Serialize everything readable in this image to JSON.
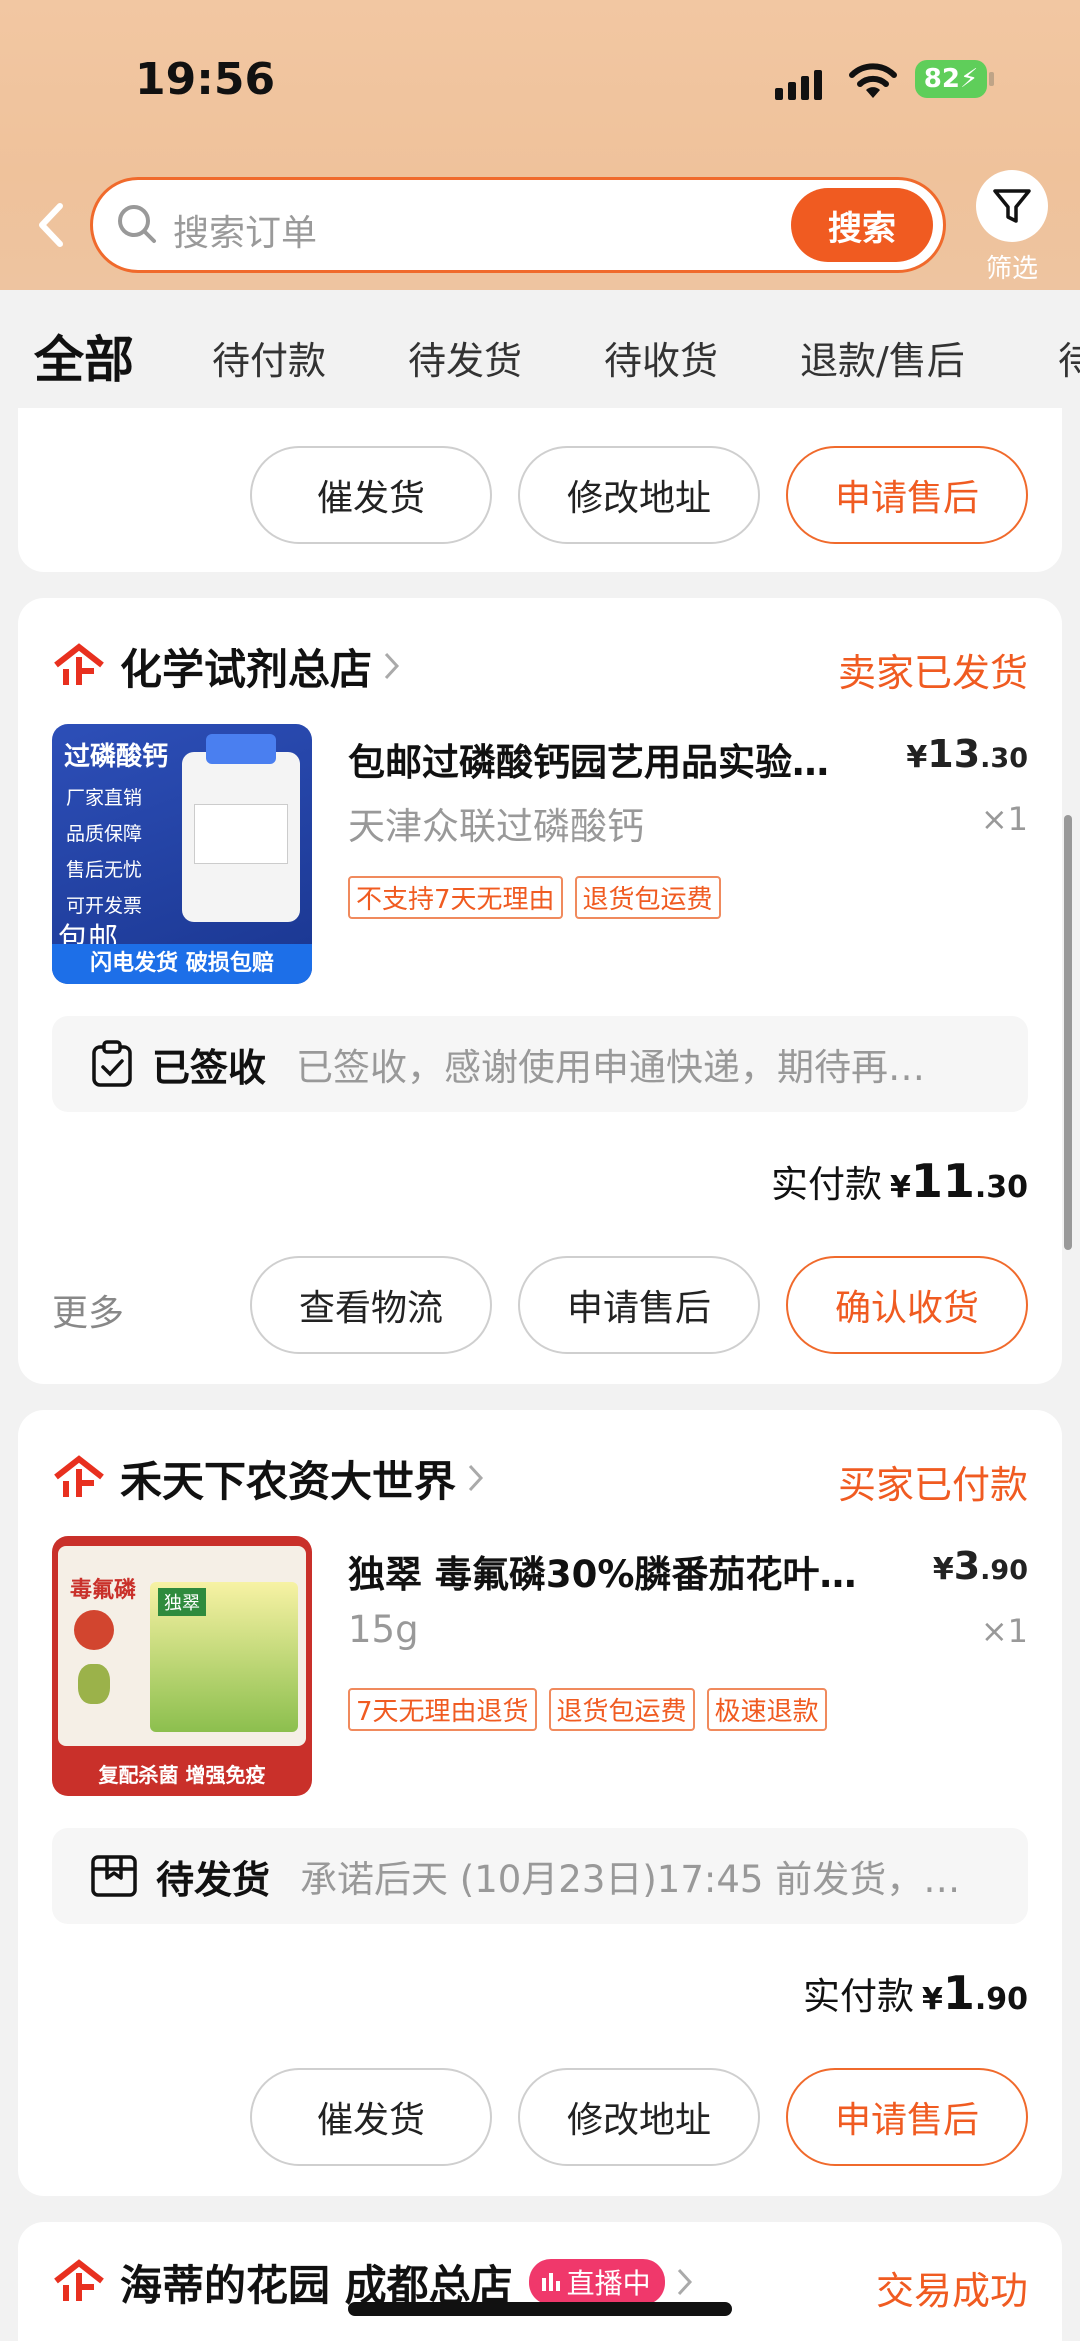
{
  "status_bar": {
    "time": "19:56",
    "battery": "82"
  },
  "search": {
    "placeholder": "搜索订单",
    "button": "搜索",
    "filter_label": "筛选"
  },
  "tabs": [
    "全部",
    "待付款",
    "待发货",
    "待收货",
    "退款/售后",
    "待"
  ],
  "top_card": {
    "buttons": [
      "催发货",
      "修改地址",
      "申请售后"
    ]
  },
  "orders": [
    {
      "shop": "化学试剂总店",
      "state": "卖家已发货",
      "product_title": "包邮过磷酸钙园艺用品实验…",
      "price_symbol": "¥",
      "price_int": "13",
      "price_dec": ".30",
      "spec": "天津众联过磷酸钙",
      "qty": "×1",
      "tags": [
        "不支持7天无理由",
        "退货包运费"
      ],
      "thumb": {
        "lines": [
          "过磷酸钙",
          "厂家直销",
          "品质保障",
          "售后无忧",
          "可开发票"
        ],
        "badge": "包邮",
        "footer": "闪电发货 破损包赔"
      },
      "logistics_status": "已签收",
      "logistics_msg": "已签收，感谢使用申通快递，期待再…",
      "paid_label": "实付款",
      "paid_int": "11",
      "paid_dec": ".30",
      "more": "更多",
      "buttons": [
        "查看物流",
        "申请售后",
        "确认收货"
      ]
    },
    {
      "shop": "禾天下农资大世界",
      "state": "买家已付款",
      "product_title": "独翠 毒氟磷30%膦番茄花叶…",
      "price_symbol": "¥",
      "price_int": "3",
      "price_dec": ".90",
      "spec": "15g",
      "qty": "×1",
      "tags": [
        "7天无理由退货",
        "退货包运费",
        "极速退款"
      ],
      "thumb": {
        "lines": [
          "毒氟磷",
          "独翠"
        ],
        "footer": "复配杀菌 增强免疫"
      },
      "logistics_status": "待发货",
      "logistics_msg": "承诺后天 (10月23日)17:45 前发货，…",
      "paid_label": "实付款",
      "paid_int": "1",
      "paid_dec": ".90",
      "buttons": [
        "催发货",
        "修改地址",
        "申请售后"
      ]
    },
    {
      "shop": "海蒂的花园 成都总店",
      "live": "直播中",
      "state": "交易成功"
    }
  ]
}
